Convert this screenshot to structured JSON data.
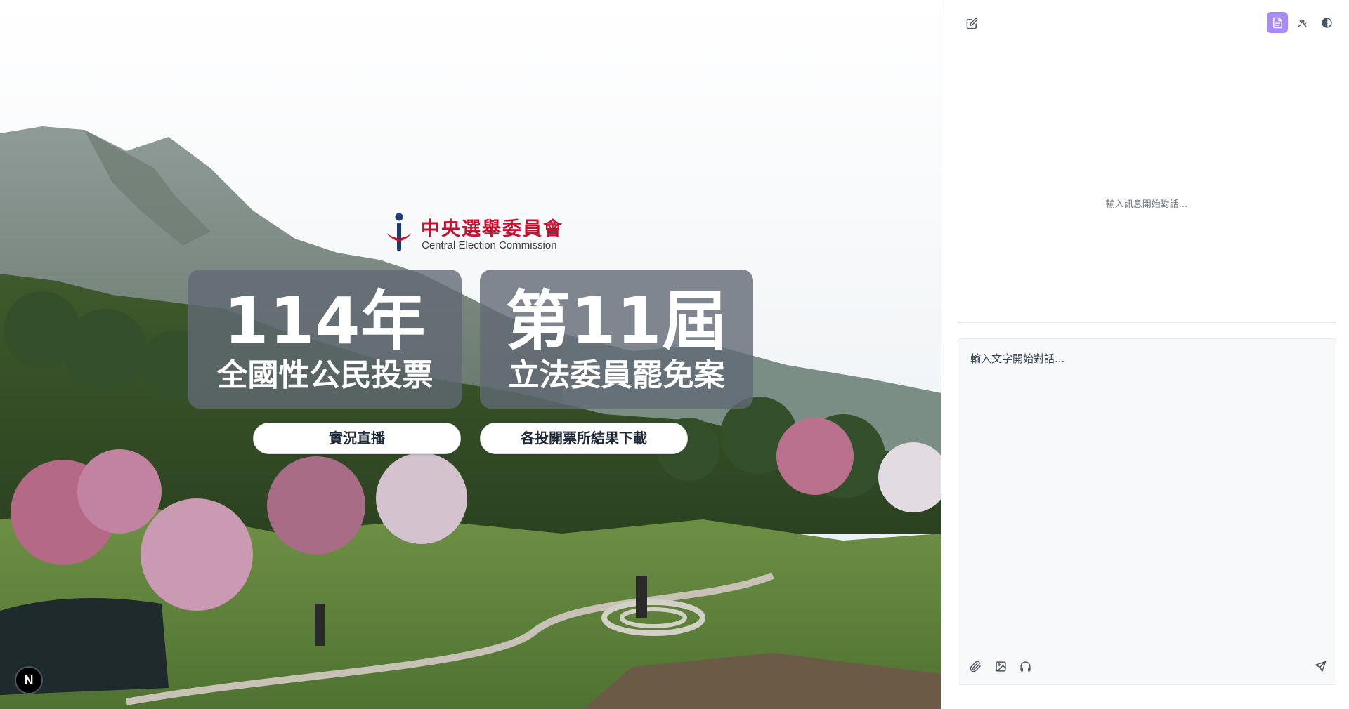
{
  "hero": {
    "logo": {
      "name_cn": "中央選舉委員會",
      "name_en": "Central Election Commission"
    },
    "cards": [
      {
        "big": "114年",
        "small": "全國性公民投票"
      },
      {
        "big": "第11屆",
        "small": "立法委員罷免案"
      }
    ],
    "buttons": {
      "live": "實況直播",
      "download": "各投開票所結果下載"
    },
    "badge": "N"
  },
  "panel": {
    "toolbar": {
      "left_icons": [
        "edit-icon"
      ],
      "right_icons": [
        "document-icon",
        "puzzle-icon",
        "contrast-icon"
      ],
      "active_icon": "document-icon",
      "accent_color": "#a78bfa"
    },
    "empty_message": "輸入訊息開始對話...",
    "composer": {
      "placeholder": "輸入文字開始對話...",
      "tools": [
        "paperclip-icon",
        "image-icon",
        "headphones-icon"
      ],
      "send_icon": "send-icon"
    }
  }
}
